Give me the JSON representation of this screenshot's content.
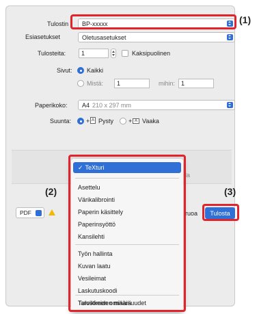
{
  "printer": {
    "label": "Tulostin",
    "value": "BP-xxxxx"
  },
  "presets": {
    "label": "Esiasetukset",
    "value": "Oletusasetukset"
  },
  "copies": {
    "label": "Tulosteita:",
    "value": "1",
    "duplex_label": "Kaksipuolinen"
  },
  "pages": {
    "label": "Sivut:",
    "all_label": "Kaikki",
    "from_label": "Mistä:",
    "from_value": "1",
    "to_label": "mihin:",
    "to_value": "1"
  },
  "paper_size": {
    "label": "Paperikoko:",
    "value": "A4",
    "dimensions": "210 x 297 mm"
  },
  "orientation": {
    "label": "Suunta:",
    "portrait_label": "Pysty",
    "landscape_label": "Vaaka"
  },
  "menu": {
    "selected": "TeXturi",
    "group1": [
      "Asettelu",
      "Värikalibrointi",
      "Paperin käsittely",
      "Paperinsyöttö",
      "Kansilehti"
    ],
    "group2": [
      "Työn hallinta",
      "Kuvan laatu",
      "Vesileimat",
      "Laskutuskoodi",
      "Tulostimen ominaisuudet"
    ],
    "group3": [
      "Tarvikkeiden määrä"
    ]
  },
  "footer": {
    "pdf_label": "PDF",
    "cancel_partial": "ruoa",
    "print_label": "Tulosta",
    "hidden_partial": "la"
  },
  "callouts": {
    "c1": "(1)",
    "c2": "(2)",
    "c3": "(3)"
  },
  "colors": {
    "accent": "#2f6fd6",
    "callout_box": "#e1242b",
    "warning": "#f5b800"
  }
}
